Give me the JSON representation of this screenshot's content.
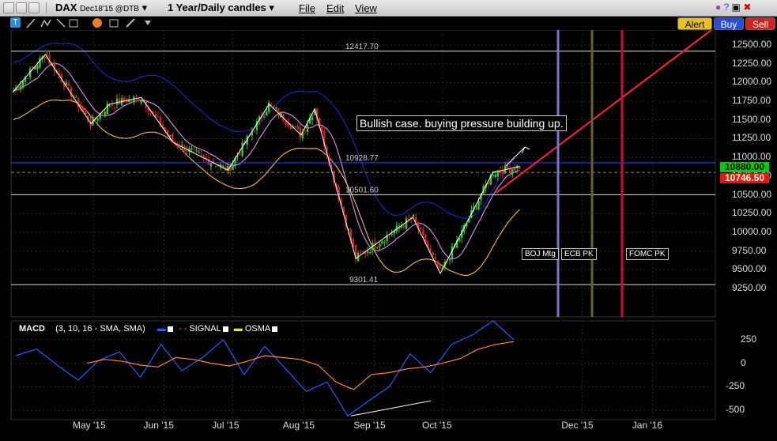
{
  "window": {
    "symbol": "DAX",
    "contract": "Dec18'15 @DTB",
    "period": "1 Year/Daily candles",
    "menus": [
      "File",
      "Edit",
      "View"
    ]
  },
  "actions": {
    "alert": "Alert",
    "buy": "Buy",
    "sell": "Sell"
  },
  "colors": {
    "up": "#33cc33",
    "down": "#dd2222",
    "upper_band": "#2222bb",
    "mid_band": "#cc88dd",
    "lower_band": "#e8b040",
    "macd_line": "#3355ff",
    "signal_line": "#ff8833",
    "boj_line": "#7777cc",
    "ecb_line": "#66661a",
    "fomc_line": "#cc1133",
    "trend_line": "#ff2244",
    "last_tag": "#00cc00",
    "bid_tag": "#ee1111"
  },
  "annotations": {
    "callout": "Bullish case. buying pressure building up.",
    "level_12417": "12417.70",
    "level_10928": "10928.77",
    "level_10501": "10501.60",
    "level_9301": "9301.41"
  },
  "events": {
    "boj": "BOJ Mtg",
    "ecb": "ECB PK",
    "fomc": "FOMC PK"
  },
  "price_tags": {
    "last": "10880.00",
    "bid": "10746.50"
  },
  "macd": {
    "title": "MACD",
    "params": "(3, 10, 16 - SMA, SMA)",
    "signal": "SIGNAL",
    "osma": "OSMA"
  },
  "chart_data": [
    {
      "type": "candlestick",
      "title": "",
      "y_ticks": [
        "12500.00",
        "12250.00",
        "12000.00",
        "11750.00",
        "11500.00",
        "11250.00",
        "11000.00",
        "10750.00",
        "10500.00",
        "10250.00",
        "10000.00",
        "9750.00",
        "9500.00",
        "9250.00"
      ],
      "ylim": [
        9100,
        12600
      ],
      "x_ticks": [
        "May '15",
        "Jun '15",
        "Jul '15",
        "Aug '15",
        "Sep '15",
        "Oct '15",
        "Dec '15",
        "Jan '16"
      ],
      "horizontal_levels": [
        12417.7,
        10928.77,
        10501.6,
        9301.41
      ],
      "close_path": [
        {
          "date": "2015-03-27",
          "close": 11880
        },
        {
          "date": "2015-04-10",
          "close": 12374
        },
        {
          "date": "2015-04-30",
          "close": 11450
        },
        {
          "date": "2015-05-08",
          "close": 11710
        },
        {
          "date": "2015-05-22",
          "close": 11800
        },
        {
          "date": "2015-06-05",
          "close": 11200
        },
        {
          "date": "2015-06-29",
          "close": 10830
        },
        {
          "date": "2015-07-17",
          "close": 11710
        },
        {
          "date": "2015-07-31",
          "close": 11300
        },
        {
          "date": "2015-08-06",
          "close": 11650
        },
        {
          "date": "2015-08-24",
          "close": 9650
        },
        {
          "date": "2015-09-18",
          "close": 10200
        },
        {
          "date": "2015-09-30",
          "close": 9450
        },
        {
          "date": "2015-10-23",
          "close": 10800
        },
        {
          "date": "2015-11-04",
          "close": 10880
        }
      ]
    },
    {
      "type": "line",
      "title": "MACD",
      "y_ticks": [
        "250",
        "0",
        "-250",
        "-500"
      ],
      "ylim": [
        -600,
        450
      ],
      "series": [
        {
          "name": "MACD",
          "values": [
            80,
            150,
            -20,
            -180,
            30,
            120,
            -150,
            200,
            -80,
            60,
            250,
            -120,
            180,
            -60,
            -300,
            -200,
            -560,
            -400,
            -250,
            100,
            -100,
            200,
            300,
            450,
            250
          ]
        },
        {
          "name": "SIGNAL",
          "values": [
            0,
            40,
            20,
            -20,
            -40,
            60,
            40,
            0,
            -30,
            20,
            80,
            60,
            40,
            -20,
            -200,
            -280,
            -120,
            -100,
            -60,
            -40,
            0,
            50,
            150,
            200,
            230
          ]
        }
      ]
    }
  ]
}
